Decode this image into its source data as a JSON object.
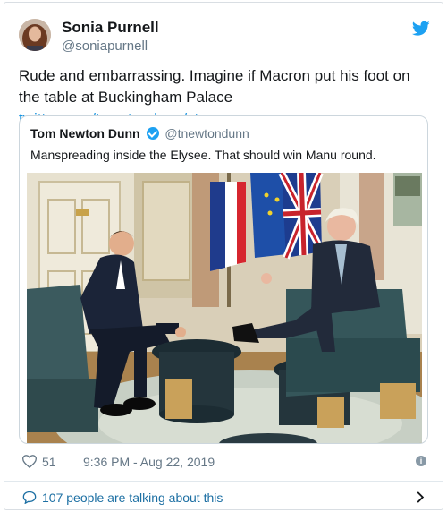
{
  "tweet": {
    "author_name": "Sonia Purnell",
    "author_handle": "@soniapurnell",
    "text": "Rude and embarrassing. Imagine if Macron put his foot on the table at Buckingham Palace ",
    "link_text": "twitter.com/tnewtondunn/st…",
    "likes": "51",
    "timestamp": "9:36 PM - Aug 22, 2019",
    "talking": "107 people are talking about this",
    "icons": [
      "twitter-bird-icon",
      "heart-icon",
      "info-icon",
      "speech-bubble-icon",
      "chevron-right-icon"
    ]
  },
  "quoted": {
    "author_name": "Tom Newton Dunn",
    "author_handle": "@tnewtondunn",
    "text": "Manspreading inside the Elysee. That should win Manu round."
  },
  "colors": {
    "link": "#1b95e0",
    "secondary": "#657786",
    "twitter_blue": "#1da1f2"
  }
}
